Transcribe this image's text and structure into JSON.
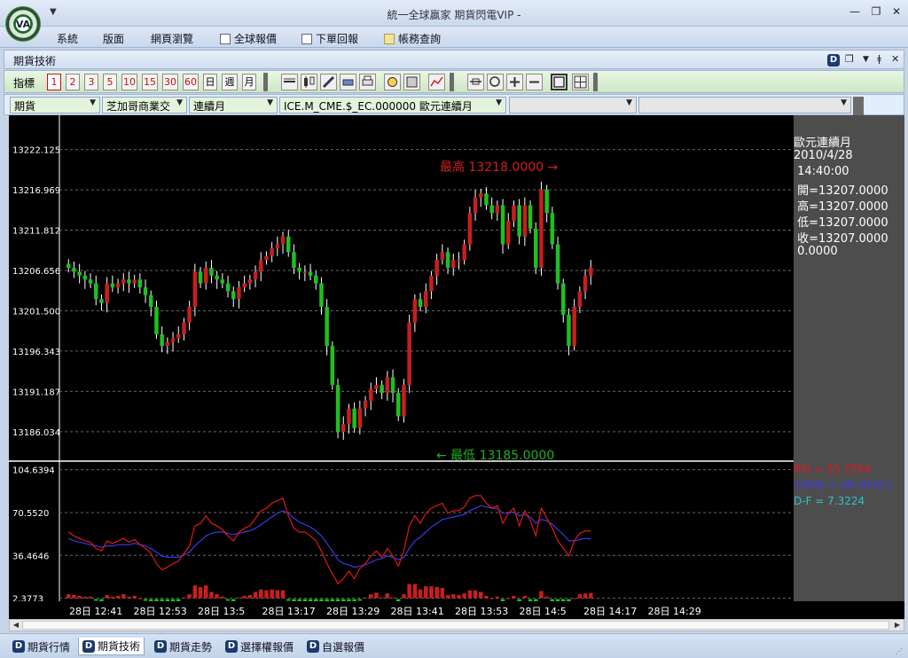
{
  "window": {
    "title": "統一全球贏家 期貨閃電VIP -",
    "logo_text": "VA",
    "quick_access_icon": "dropdown-arrow-icon",
    "controls": [
      "minimize-icon",
      "restore-icon",
      "close-icon"
    ]
  },
  "menu": {
    "items": [
      {
        "label": "系統",
        "icon": ""
      },
      {
        "label": "版面",
        "icon": ""
      },
      {
        "label": "網頁瀏覽",
        "icon": ""
      },
      {
        "label": "全球報價",
        "icon": "pin-icon"
      },
      {
        "label": "下單回報",
        "icon": "edit-icon"
      },
      {
        "label": "帳務查詢",
        "icon": "document-icon"
      }
    ]
  },
  "panel": {
    "title": "期貨技術",
    "controls": [
      "d-badge-icon",
      "window-icon",
      "dropdown-arrow-icon",
      "pin-icon",
      "close-icon"
    ]
  },
  "toolbar": {
    "label": "指標",
    "period_buttons": [
      "1",
      "2",
      "3",
      "5",
      "10",
      "15",
      "30",
      "60",
      "日",
      "週",
      "月"
    ],
    "active_period": "1",
    "tool_icons": [
      "line-icon",
      "candlestick-icon",
      "pencil-icon",
      "eraser-icon",
      "print-icon",
      "refresh-icon",
      "image-icon",
      "trend-chart-icon",
      "resize-horizontal-icon",
      "zoom-icon",
      "plus-icon",
      "minus-icon",
      "layout-single-icon",
      "layout-grid-icon"
    ]
  },
  "filters": {
    "market": "期貨",
    "exchange": "芝加哥商業交",
    "contract_type": "連續月",
    "symbol": "ICE.M_CME.$_EC.000000 歐元連續月",
    "extra1": "",
    "extra2": ""
  },
  "info": {
    "name": "歐元連續月",
    "date": "2010/4/28",
    "time": " 14:40:00",
    "open": " 開=13207.0000",
    "high": " 高=13207.0000",
    "low": " 低=13207.0000",
    "close": " 收=13207.0000",
    "volume": " 0.0000"
  },
  "indicators": {
    "rsi": "RSI = 55.7584",
    "rsi10": "10RSI = 49.4040↓",
    "df": "D-F = 7.3224"
  },
  "annotations": {
    "high_label": "最高 13218.0000 →",
    "low_label": "← 最低 13185.0000"
  },
  "colors": {
    "up": "#c81e1e",
    "down": "#1fbf1f",
    "rsi": "#e01818",
    "rsi10": "#3a3ae6",
    "df": "#30c0c8",
    "high_text": "#d02020",
    "low_text": "#20b020"
  },
  "time_labels": [
    "28日 12:41",
    "28日 12:53",
    "28日 13:5",
    "28日 13:17",
    "28日 13:29",
    "28日 13:41",
    "28日 13:53",
    "28日 14:5",
    "28日 14:17",
    "28日 14:29"
  ],
  "chart_data": {
    "type": "candlestick",
    "y_ticks": [
      "13222.125",
      "13216.969",
      "13211.812",
      "13206.656",
      "13201.500",
      "13196.343",
      "13191.187",
      "13186.034"
    ],
    "y_tick_values": [
      13222.125,
      13216.969,
      13211.812,
      13206.656,
      13201.5,
      13196.343,
      13191.187,
      13186.034
    ],
    "ylim": [
      13182.5,
      13226.5
    ],
    "close": [
      13207,
      13206.5,
      13206,
      13205.5,
      13205,
      13203,
      13202.5,
      13205,
      13204.5,
      13205,
      13205.5,
      13205,
      13205.5,
      13204.5,
      13203.5,
      13202,
      13198.5,
      13197,
      13197.5,
      13198,
      13198.5,
      13200,
      13202,
      13206.5,
      13205,
      13207,
      13206,
      13205.5,
      13205,
      13204,
      13203,
      13204.5,
      13205,
      13205.5,
      13206.5,
      13208,
      13208.5,
      13209.5,
      13210,
      13211,
      13209,
      13207,
      13206.5,
      13206.5,
      13206,
      13205,
      13202,
      13197,
      13192,
      13186,
      13187,
      13189,
      13186.5,
      13189,
      13190,
      13191.5,
      13192,
      13191,
      13193,
      13191,
      13188,
      13192,
      13200,
      13203,
      13202,
      13204,
      13206,
      13208,
      13209,
      13207,
      13208,
      13208,
      13210,
      13214,
      13216,
      13216.5,
      13215,
      13214,
      13215,
      13210,
      13213,
      13215,
      13211,
      13215,
      13212,
      13207,
      13217,
      13214,
      13210,
      13205,
      13201,
      13197,
      13202,
      13204,
      13206,
      13207
    ],
    "high_point": 13218.0,
    "low_point": 13185.0,
    "rsi": [
      55,
      52,
      50,
      48,
      47,
      42,
      40,
      48,
      46,
      48,
      50,
      47,
      49,
      45,
      42,
      38,
      30,
      25,
      27,
      30,
      32,
      38,
      44,
      60,
      62,
      68,
      62,
      60,
      57,
      52,
      48,
      55,
      58,
      60,
      66,
      72,
      74,
      78,
      80,
      82,
      68,
      58,
      55,
      55,
      52,
      48,
      40,
      30,
      22,
      14,
      18,
      24,
      18,
      26,
      30,
      36,
      40,
      35,
      42,
      36,
      28,
      40,
      60,
      68,
      62,
      70,
      74,
      76,
      78,
      70,
      72,
      72,
      75,
      82,
      84,
      84,
      78,
      74,
      76,
      62,
      70,
      74,
      60,
      72,
      64,
      52,
      74,
      66,
      58,
      48,
      42,
      36,
      48,
      54,
      56,
      56
    ],
    "rsi10": [
      50,
      48,
      47,
      46,
      45,
      44,
      43,
      44,
      44,
      45,
      45,
      45,
      46,
      45,
      44,
      42,
      39,
      36,
      35,
      35,
      35,
      37,
      39,
      44,
      48,
      52,
      54,
      55,
      55,
      54,
      53,
      54,
      55,
      56,
      58,
      61,
      64,
      67,
      70,
      72,
      70,
      66,
      63,
      61,
      59,
      56,
      52,
      46,
      40,
      33,
      30,
      29,
      27,
      28,
      29,
      31,
      33,
      34,
      36,
      35,
      33,
      35,
      42,
      48,
      51,
      55,
      59,
      62,
      65,
      66,
      67,
      68,
      69,
      72,
      74,
      76,
      75,
      74,
      74,
      70,
      70,
      71,
      68,
      69,
      67,
      62,
      65,
      64,
      61,
      57,
      53,
      48,
      48,
      49,
      50,
      49.4
    ],
    "rsi_axis": [
      "104.6394",
      "70.5520",
      "36.4646",
      "2.3773"
    ],
    "rsi_axis_values": [
      104.6394,
      70.552,
      36.4646,
      2.3773
    ]
  }
}
